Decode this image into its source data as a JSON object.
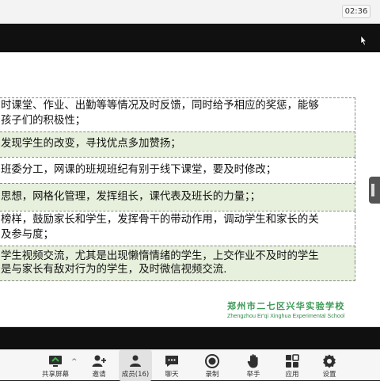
{
  "window": {
    "clock": "02:36"
  },
  "slide": {
    "rows": [
      {
        "text": "时课堂、作业、出勤等等情况及时反馈，同时给予相应的奖惩，能够",
        "style": "white"
      },
      {
        "text": "孩子们的积极性；",
        "style": "white"
      },
      {
        "text": "发现学生的改变，寻找优点多加赞扬；",
        "style": "green"
      },
      {
        "text": "班委分工，网课的班规班纪有别于线下课堂，要及时修改；",
        "style": "white"
      },
      {
        "text": "思想，网格化管理，发挥组长，课代表及班长的力量；；",
        "style": "green"
      },
      {
        "text": "榜样，鼓励家长和学生，发挥骨干的带动作用，调动学生和家长的关",
        "style": "white"
      },
      {
        "text": "及参与度；",
        "style": "white"
      },
      {
        "text": "学生视频交流，尤其是出现懒惰情绪的学生，上交作业不及时的学生",
        "style": "green"
      },
      {
        "text": "是与家长有敌对行为的学生，及时微信视频交流.",
        "style": "green"
      }
    ],
    "school_name_cn": "郑州市二七区兴华实验学校",
    "school_name_en": "Zhengzhou Er'qi Xinghua Experimental School",
    "accent_green": "#3a9a55",
    "row_green": "#e7f0dc"
  },
  "toolbar": {
    "items": [
      {
        "label": "共享屏幕",
        "icon": "share-screen-icon",
        "active": false
      },
      {
        "label": "邀请",
        "icon": "invite-icon",
        "active": false
      },
      {
        "label": "成员(16)",
        "icon": "members-icon",
        "active": true
      },
      {
        "label": "聊天",
        "icon": "chat-icon",
        "active": false
      },
      {
        "label": "录制",
        "icon": "record-icon",
        "active": false
      },
      {
        "label": "举手",
        "icon": "raise-hand-icon",
        "active": false
      },
      {
        "label": "应用",
        "icon": "apps-icon",
        "active": false
      },
      {
        "label": "设置",
        "icon": "settings-icon",
        "active": false
      }
    ],
    "share_caret": "^"
  }
}
